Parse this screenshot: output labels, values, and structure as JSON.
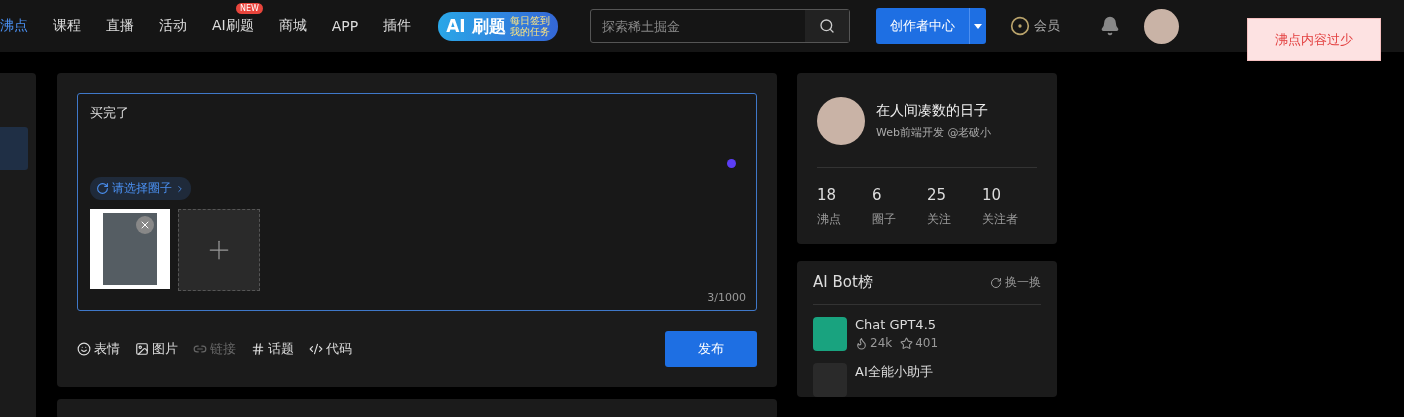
{
  "nav": {
    "items": [
      {
        "label": "沸点",
        "selected": true
      },
      {
        "label": "课程",
        "selected": false
      },
      {
        "label": "直播",
        "selected": false
      },
      {
        "label": "活动",
        "selected": false
      },
      {
        "label": "AI刷题",
        "selected": false,
        "badge": "NEW"
      },
      {
        "label": "商城",
        "selected": false
      },
      {
        "label": "APP",
        "selected": false
      },
      {
        "label": "插件",
        "selected": false
      }
    ],
    "promo": {
      "title": "AI 刷题",
      "line_1": "每日签到",
      "line_2": "我的任务"
    },
    "search": {
      "placeholder": "探索稀土掘金"
    },
    "creator_button": "创作者中心",
    "vip": "会员"
  },
  "toast": "沸点内容过少",
  "composer": {
    "text": "买完了",
    "circle": "请选择圈子",
    "counter": "3/1000",
    "tools": [
      {
        "kind": "emoji",
        "label": "表情",
        "disabled": false
      },
      {
        "kind": "image",
        "label": "图片",
        "disabled": false
      },
      {
        "kind": "link",
        "label": "链接",
        "disabled": true
      },
      {
        "kind": "topic",
        "label": "话题",
        "disabled": false
      },
      {
        "kind": "code",
        "label": "代码",
        "disabled": false
      }
    ],
    "publish": "发布"
  },
  "profile": {
    "name": "在人间凑数的日子",
    "subtitle": "Web前端开发 @老破小",
    "stats": [
      {
        "value": "18",
        "label": "沸点"
      },
      {
        "value": "6",
        "label": "圈子"
      },
      {
        "value": "25",
        "label": "关注"
      },
      {
        "value": "10",
        "label": "关注者"
      }
    ]
  },
  "bots": {
    "title": "AI Bot榜",
    "refresh": "换一换",
    "items": [
      {
        "name": "Chat GPT4.5",
        "hot": "24k",
        "stars": "401",
        "color": "#19a37f"
      },
      {
        "name": "AI全能小助手",
        "color": "#2a2a2a"
      }
    ]
  }
}
